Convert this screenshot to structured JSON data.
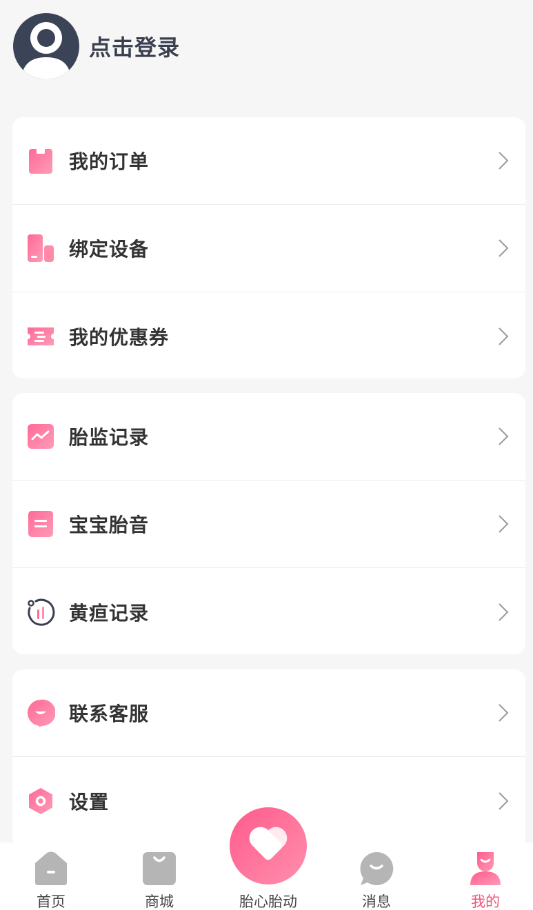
{
  "profile": {
    "login_label": "点击登录"
  },
  "group1": [
    {
      "label": "我的订单",
      "icon": "order-icon"
    },
    {
      "label": "绑定设备",
      "icon": "device-icon"
    },
    {
      "label": "我的优惠券",
      "icon": "coupon-icon"
    }
  ],
  "group2": [
    {
      "label": "胎监记录",
      "icon": "fetal-monitor-chart-icon"
    },
    {
      "label": "宝宝胎音",
      "icon": "fetal-sound-icon"
    },
    {
      "label": "黄疸记录",
      "icon": "jaundice-gauge-icon"
    }
  ],
  "group3": [
    {
      "label": "联系客服",
      "icon": "customer-service-icon"
    },
    {
      "label": "设置",
      "icon": "settings-icon"
    }
  ],
  "tabbar": {
    "items": [
      {
        "label": "首页",
        "icon": "home-icon",
        "active": false
      },
      {
        "label": "商城",
        "icon": "shop-bag-icon",
        "active": false
      },
      {
        "label": "胎心胎动",
        "icon": "heart-icon",
        "active": false
      },
      {
        "label": "消息",
        "icon": "message-icon",
        "active": false
      },
      {
        "label": "我的",
        "icon": "profile-icon",
        "active": true
      }
    ]
  },
  "colors": {
    "accent": "#ff5b8b",
    "accent_light": "#ff8fae",
    "avatar_bg": "#3b4457",
    "inactive_icon": "#b5b5b5",
    "active_label": "#f0577e"
  }
}
